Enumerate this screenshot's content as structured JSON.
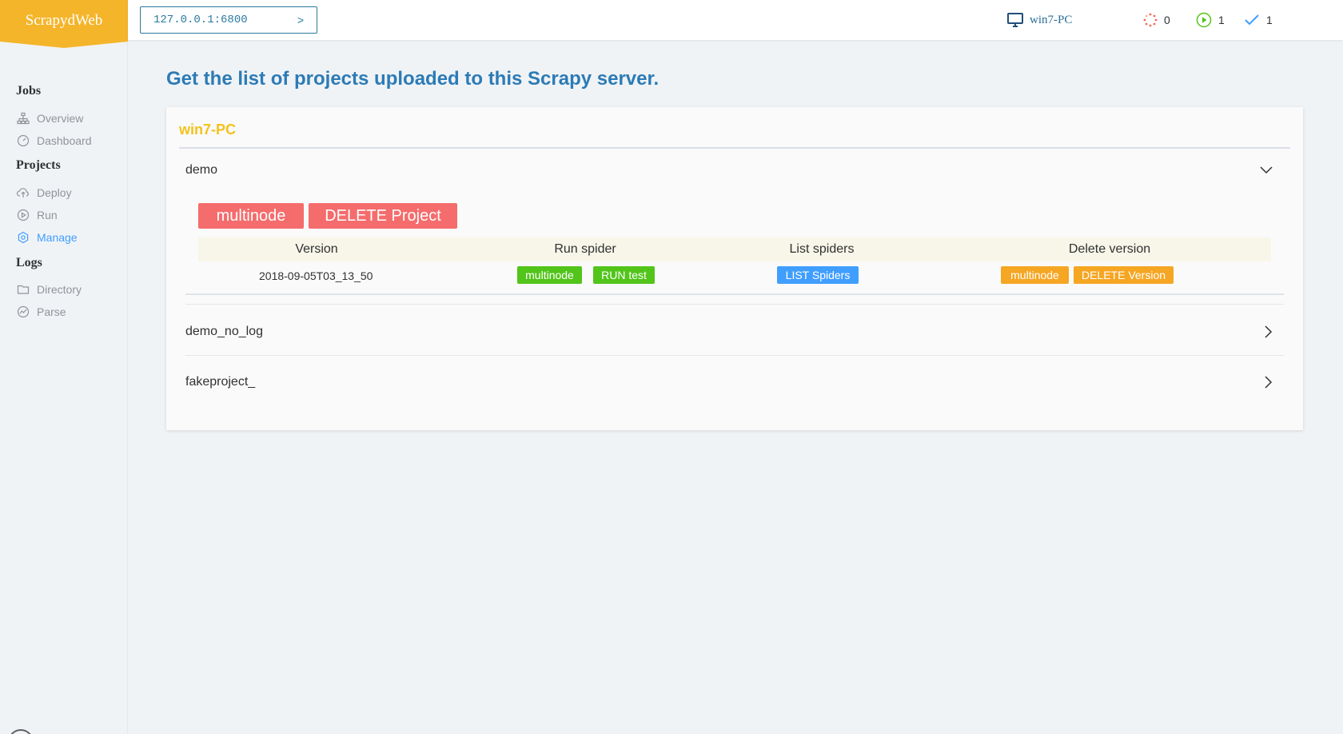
{
  "app": {
    "logo": "ScrapydWeb"
  },
  "header": {
    "server": "127.0.0.1:6800",
    "server_chevron": ">",
    "host": "win7-PC",
    "pending_count": "0",
    "running_count": "1",
    "finished_count": "1"
  },
  "sidebar": {
    "groups": [
      {
        "label": "Jobs",
        "items": [
          {
            "label": "Overview",
            "icon": "sitemap-icon"
          },
          {
            "label": "Dashboard",
            "icon": "speedometer-icon"
          }
        ]
      },
      {
        "label": "Projects",
        "items": [
          {
            "label": "Deploy",
            "icon": "upload-cloud-icon"
          },
          {
            "label": "Run",
            "icon": "play-circle-icon"
          },
          {
            "label": "Manage",
            "icon": "gear-icon",
            "active": true
          }
        ]
      },
      {
        "label": "Logs",
        "items": [
          {
            "label": "Directory",
            "icon": "folder-icon"
          },
          {
            "label": "Parse",
            "icon": "chart-icon"
          }
        ]
      }
    ]
  },
  "main": {
    "title": "Get the list of projects uploaded to this Scrapy server.",
    "card_title": "win7-PC",
    "projects": [
      {
        "name": "demo",
        "expanded": true,
        "actions": {
          "multinode": "multinode",
          "delete": "DELETE Project"
        },
        "table": {
          "headers": [
            "Version",
            "Run spider",
            "List spiders",
            "Delete version"
          ],
          "rows": [
            {
              "version": "2018-09-05T03_13_50",
              "run_multinode": "multinode",
              "run_test": "RUN test",
              "list_spiders": "LIST Spiders",
              "delete_multinode": "multinode",
              "delete_version": "DELETE Version"
            }
          ]
        }
      },
      {
        "name": "demo_no_log",
        "expanded": false
      },
      {
        "name": "fakeproject_",
        "expanded": false
      }
    ]
  },
  "colors": {
    "accent": "#f5b52a",
    "title_blue": "#2c7bb6",
    "card_title": "#f5c21b",
    "danger": "#f56c6c",
    "success": "#52c41a",
    "primary": "#409eff",
    "warning": "#f5a623"
  }
}
